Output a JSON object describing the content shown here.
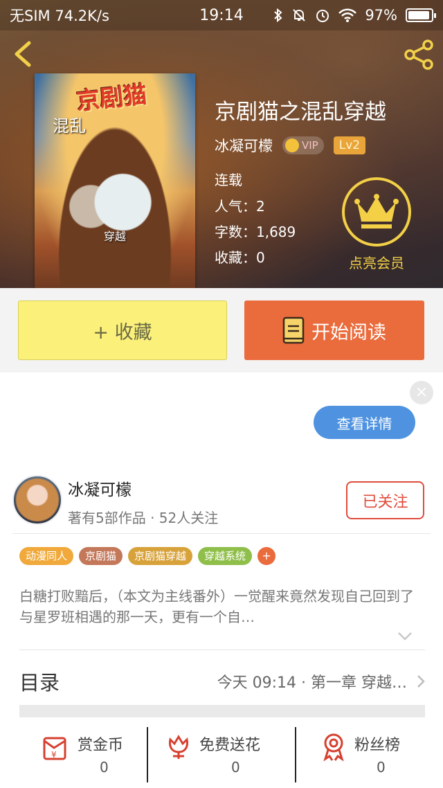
{
  "status_bar": {
    "carrier": "无SIM",
    "speed": "74.2K/s",
    "time": "19:14",
    "battery": "97%"
  },
  "book": {
    "cover_title": "京剧猫",
    "cover_sub_left": "混乱",
    "cover_sub_bottom": "穿越",
    "title": "京剧猫之混乱穿越",
    "author": "冰凝可檬",
    "vip_label": "VIP",
    "level": "Lv2",
    "status": "连载",
    "popularity": "人气：2",
    "word_count": "字数：1,689",
    "favorites": "收藏：0",
    "vip_cta": "点亮会员"
  },
  "actions": {
    "favorite": "+ 收藏",
    "read": "开始阅读"
  },
  "ad": {
    "close": "×",
    "detail": "查看详情"
  },
  "author_card": {
    "name": "冰凝可檬",
    "stats": "著有5部作品 · 52人关注",
    "follow": "已关注"
  },
  "tags": [
    {
      "label": "动漫同人",
      "color": "#f0a93a"
    },
    {
      "label": "京剧猫",
      "color": "#c4785a"
    },
    {
      "label": "京剧猫穿越",
      "color": "#d8a23a"
    },
    {
      "label": "穿越系统",
      "color": "#8fbf4a"
    }
  ],
  "tag_add": "+",
  "summary": "白糖打败黯后，（本文为主线番外）一觉醒来竟然发现自己回到了与星罗班相遇的那一天，更有一个自…",
  "toc": {
    "label": "目录",
    "update": "今天 09:14 · 第一章 穿越…"
  },
  "rewards": [
    {
      "label": "赏金币",
      "count": "0",
      "icon": "red-envelope-icon"
    },
    {
      "label": "免费送花",
      "count": "0",
      "icon": "flower-icon"
    },
    {
      "label": "粉丝榜",
      "count": "0",
      "icon": "medal-icon"
    }
  ],
  "colors": {
    "accent_orange": "#ea6b3c",
    "favorite_yellow": "#fbf17a",
    "gold": "#f3d046",
    "detail_blue": "#4f93e0",
    "follow_red": "#e04b3a"
  }
}
